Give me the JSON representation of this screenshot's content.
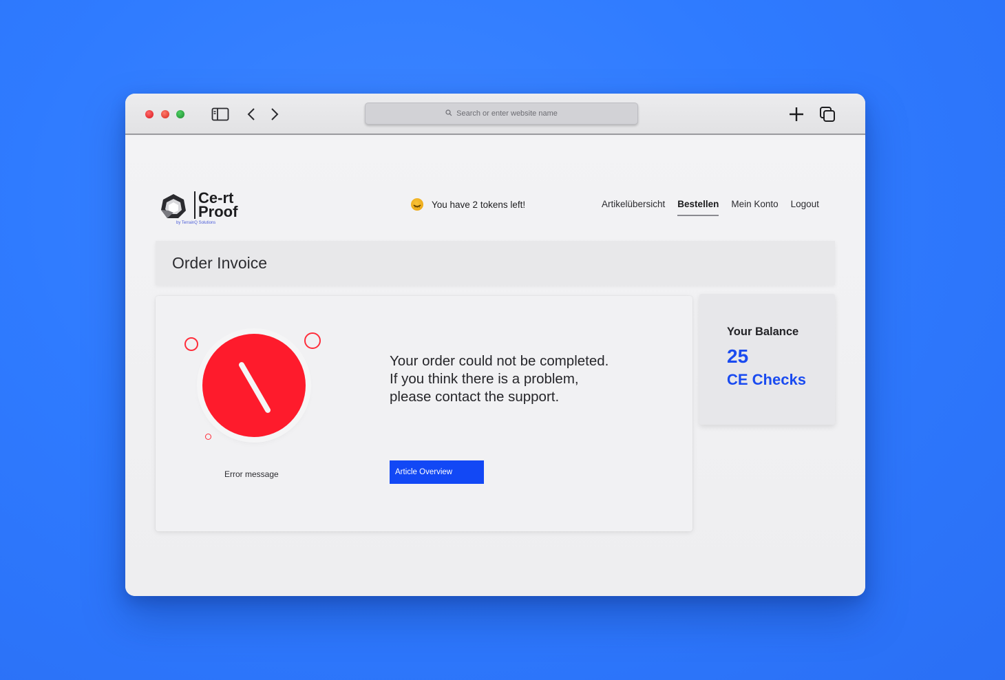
{
  "browser": {
    "search_placeholder": "Search or enter website name"
  },
  "logo": {
    "line1": "Ce-rt",
    "line2": "Proof",
    "tagline": "by TerrainQ Solutions"
  },
  "tokens_message": "You have 2 tokens left!",
  "nav": {
    "items": [
      {
        "label": "Artikelübersicht",
        "active": false
      },
      {
        "label": "Bestellen",
        "active": true
      },
      {
        "label": "Mein Konto",
        "active": false
      },
      {
        "label": "Logout",
        "active": false
      }
    ]
  },
  "page_title": "Order Invoice",
  "error": {
    "label": "Error message",
    "message_line1": "Your order could not be completed.",
    "message_line2": "If you think there is a problem,",
    "message_line3": "please contact the support.",
    "button_label": "Article Overview"
  },
  "balance": {
    "label": "Your Balance",
    "amount": "25",
    "unit": "CE Checks"
  },
  "colors": {
    "background": "#2f7bff",
    "accent": "#1248f5",
    "error": "#fe1b2c",
    "coin": "#f2b21f"
  }
}
